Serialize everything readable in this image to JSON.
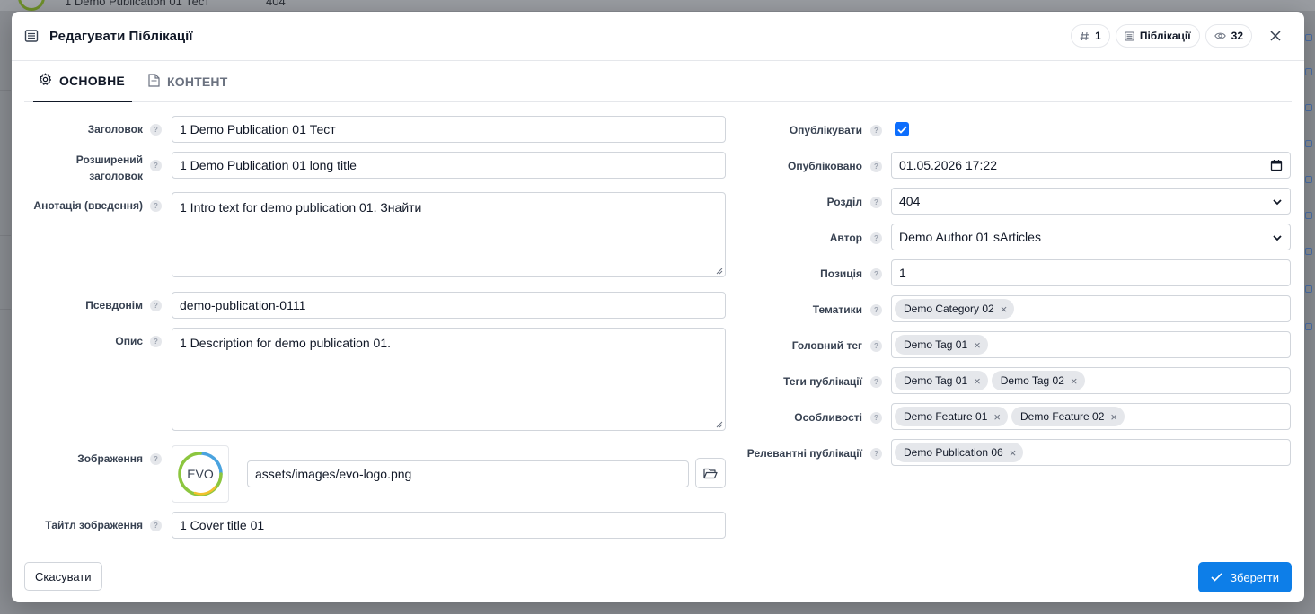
{
  "background": {
    "row_title": "1 Demo Publication 01 Тест",
    "row_number": "404"
  },
  "modal": {
    "title": "Редагувати Піблікації",
    "badges": {
      "id": "1",
      "type": "Піблікації",
      "views": "32"
    }
  },
  "tabs": [
    {
      "label": "ОСНОВНЕ",
      "icon": "gear-icon",
      "active": true
    },
    {
      "label": "КОНТЕНТ",
      "icon": "document-icon",
      "active": false
    }
  ],
  "left": {
    "title": {
      "label": "Заголовок",
      "value": "1 Demo Publication 01 Тест"
    },
    "long_title": {
      "label_line1": "Розширений",
      "label_line2": "заголовок",
      "value": "1 Demo Publication 01 long title"
    },
    "introtext": {
      "label": "Анотація (введення)",
      "value": "1 Intro text for demo publication 01. Знайти"
    },
    "alias": {
      "label": "Псевдонім",
      "value": "demo-publication-0111"
    },
    "description": {
      "label": "Опис",
      "value": "1 Description for demo publication 01."
    },
    "image": {
      "label": "Зображення",
      "path": "assets/images/evo-logo.png",
      "logo_text": "EVO"
    },
    "image_title": {
      "label": "Тайтл зображення",
      "value": "1 Cover title 01"
    }
  },
  "right": {
    "published": {
      "label": "Опублікувати",
      "checked": true
    },
    "pub_date": {
      "label": "Опубліковано",
      "value": "01.05.2026 17:22"
    },
    "section": {
      "label": "Розділ",
      "value": "404"
    },
    "author": {
      "label": "Автор",
      "value": "Demo Author 01 sArticles"
    },
    "position": {
      "label": "Позиція",
      "value": "1"
    },
    "categories": {
      "label": "Тематики",
      "chips": [
        "Demo Category 02"
      ]
    },
    "main_tag": {
      "label": "Головний тег",
      "chips": [
        "Demo Tag 01"
      ]
    },
    "tags": {
      "label": "Теги публікації",
      "chips": [
        "Demo Tag 01",
        "Demo Tag 02"
      ]
    },
    "features": {
      "label": "Особливості",
      "chips": [
        "Demo Feature 01",
        "Demo Feature 02"
      ]
    },
    "related": {
      "label": "Релевантні публікації",
      "chips": [
        "Demo Publication 06"
      ]
    }
  },
  "footer": {
    "cancel_label": "Скасувати",
    "save_label": "Зберегти"
  },
  "help_glyph": "?",
  "chip_remove_glyph": "×",
  "colors": {
    "primary": "#0d7ee8",
    "checkbox": "#0d6efd",
    "logo_green": "#8cc63f",
    "logo_blue": "#4aa3df"
  }
}
